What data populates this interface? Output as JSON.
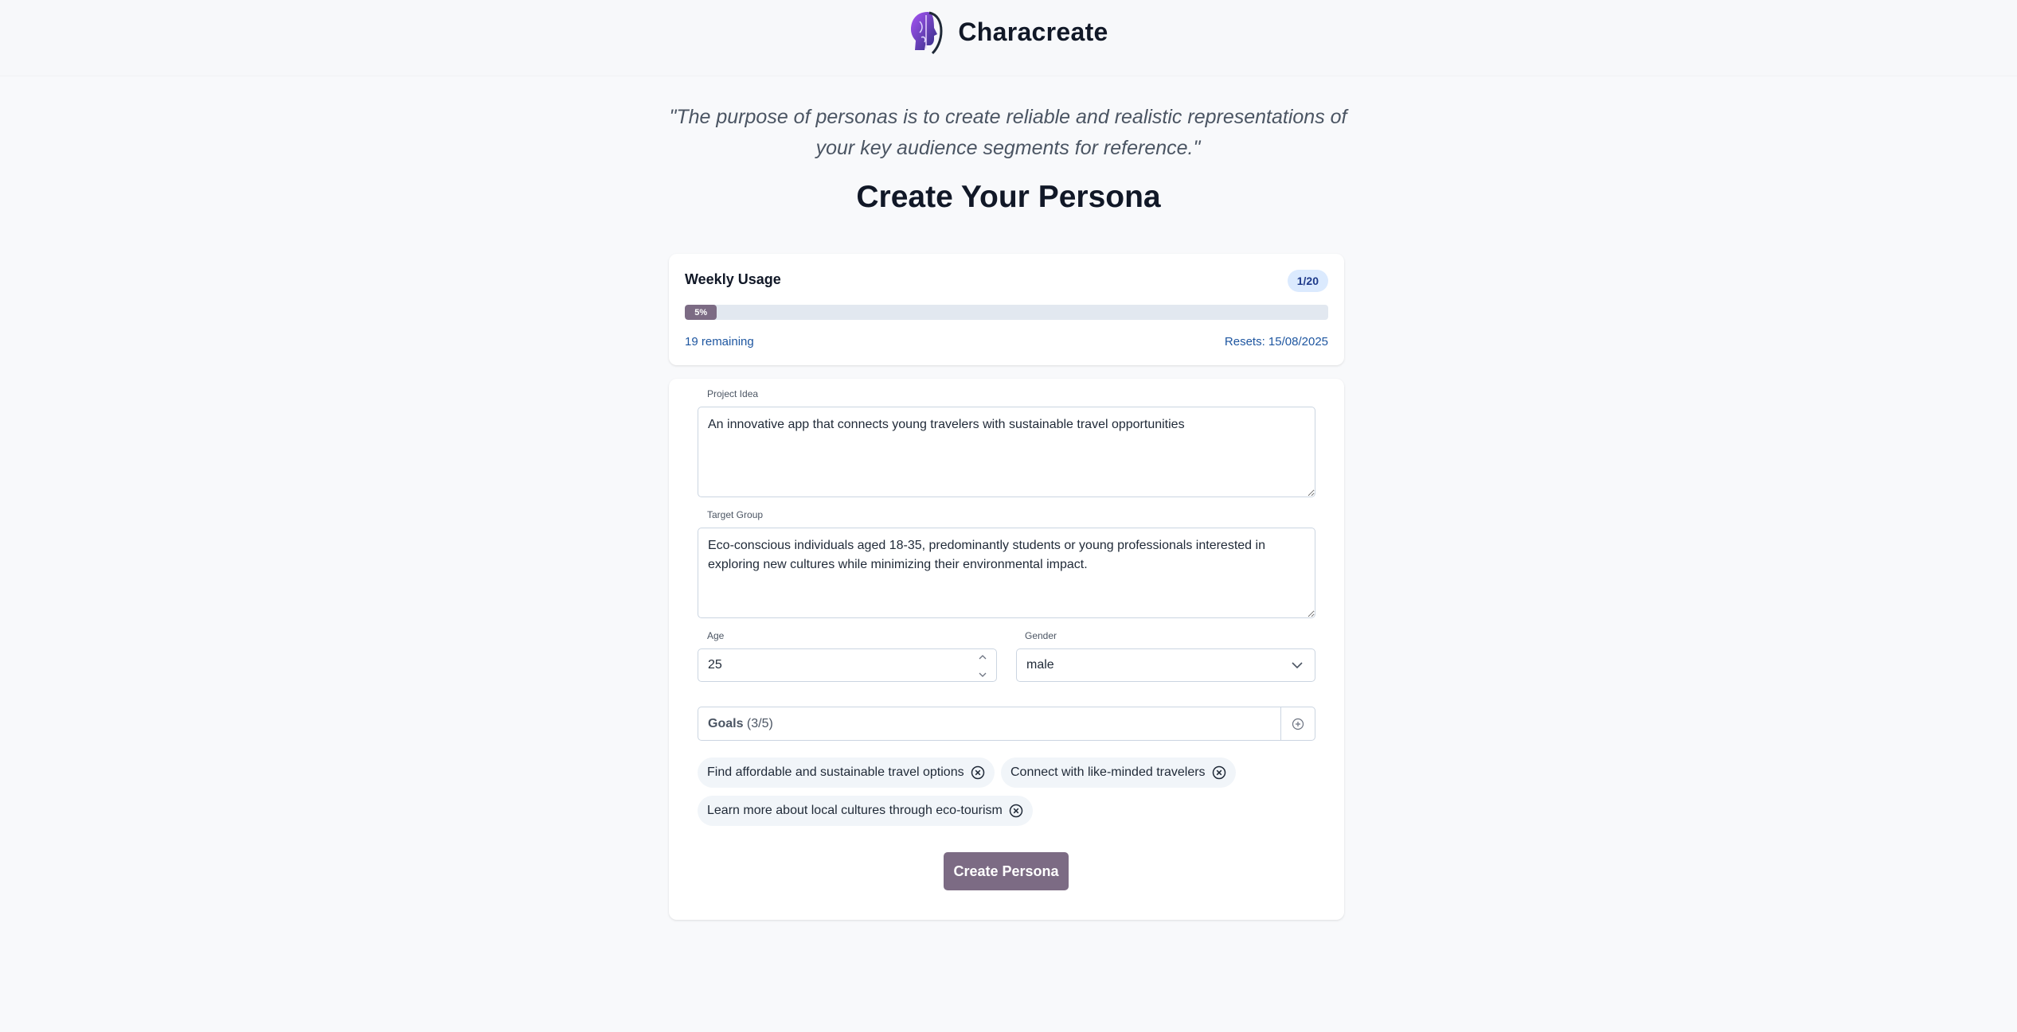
{
  "app": {
    "name": "Characreate"
  },
  "quote": "\"The purpose of personas is to create reliable and realistic representations of your key audience segments for reference.\"",
  "page_title": "Create Your Persona",
  "usage": {
    "title": "Weekly Usage",
    "badge": "1/20",
    "progress_percent": 5,
    "progress_label": "5%",
    "remaining": "19 remaining",
    "resets": "Resets: 15/08/2025"
  },
  "form": {
    "project_idea": {
      "label": "Project Idea",
      "value": "An innovative app that connects young travelers with sustainable travel opportunities"
    },
    "target_group": {
      "label": "Target Group",
      "value": "Eco-conscious individuals aged 18-35, predominantly students or young professionals interested in exploring new cultures while minimizing their environmental impact."
    },
    "age": {
      "label": "Age",
      "value": "25"
    },
    "gender": {
      "label": "Gender",
      "value": "male"
    },
    "goals": {
      "label": "Goals",
      "count": "(3/5)",
      "items": [
        "Find affordable and sustainable travel options",
        "Connect with like-minded travelers",
        "Learn more about local cultures through eco-tourism"
      ]
    },
    "submit_label": "Create Persona"
  },
  "colors": {
    "accent": "#7c6b84",
    "badge_bg": "#dbeafe",
    "link_text": "#1e56a0",
    "background": "#f8f9fb"
  }
}
